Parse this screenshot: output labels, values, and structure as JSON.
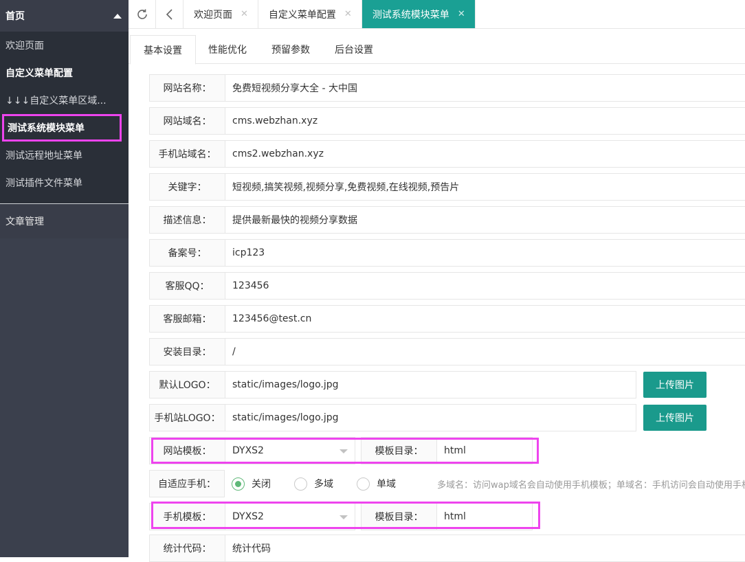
{
  "sidebar": {
    "header": "首页",
    "items": [
      {
        "label": "欢迎页面"
      },
      {
        "label": "自定义菜单配置"
      },
      {
        "label": "↓↓↓自定义菜单区域..."
      },
      {
        "label": "测试系统模块菜单"
      },
      {
        "label": "测试远程地址菜单"
      },
      {
        "label": "测试插件文件菜单"
      }
    ],
    "section2": "文章管理"
  },
  "tabbar": {
    "tabs": [
      {
        "label": "欢迎页面"
      },
      {
        "label": "自定义菜单配置"
      },
      {
        "label": "测试系统模块菜单"
      }
    ]
  },
  "subtabs": [
    "基本设置",
    "性能优化",
    "预留参数",
    "后台设置"
  ],
  "form": {
    "site_name": {
      "label": "网站名称：",
      "value": "免费短视频分享大全 - 大中国"
    },
    "site_domain": {
      "label": "网站域名：",
      "value": "cms.webzhan.xyz"
    },
    "mobile_domain": {
      "label": "手机站域名：",
      "value": "cms2.webzhan.xyz"
    },
    "keywords": {
      "label": "关键字：",
      "value": "短视频,搞笑视频,视频分享,免费视频,在线视频,预告片"
    },
    "description": {
      "label": "描述信息：",
      "value": "提供最新最快的视频分享数据"
    },
    "icp": {
      "label": "备案号：",
      "value": "icp123"
    },
    "qq": {
      "label": "客服QQ：",
      "value": "123456"
    },
    "email": {
      "label": "客服邮箱：",
      "value": "123456@test.cn"
    },
    "install_dir": {
      "label": "安装目录：",
      "value": "/"
    },
    "logo": {
      "label": "默认LOGO：",
      "value": "static/images/logo.jpg",
      "button": "上传图片"
    },
    "mobile_logo": {
      "label": "手机站LOGO：",
      "value": "static/images/logo.jpg",
      "button": "上传图片"
    },
    "template": {
      "label": "网站模板：",
      "value": "DYXS2",
      "dir_label": "模板目录：",
      "dir_value": "html"
    },
    "adaptive": {
      "label": "自适应手机：",
      "options": [
        "关闭",
        "多域",
        "单域"
      ],
      "selected": "关闭",
      "hint": "多域名：访问wap域名会自动使用手机模板；单域名：手机访问会自动使用手机模板"
    },
    "mobile_template": {
      "label": "手机模板：",
      "value": "DYXS2",
      "dir_label": "模板目录：",
      "dir_value": "html"
    },
    "stats": {
      "label": "统计代码：",
      "value": "统计代码"
    }
  },
  "colors": {
    "accent": "#1aa094",
    "highlight": "#ee44ee",
    "sidebar": "#2f3540"
  }
}
